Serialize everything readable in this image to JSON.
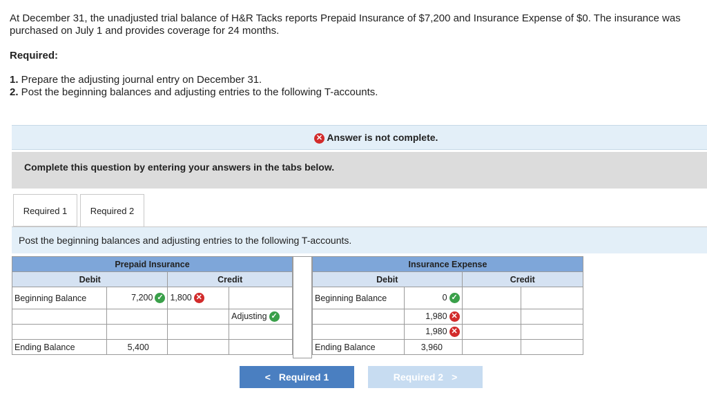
{
  "question": {
    "intro": "At December 31, the unadjusted trial balance of H&R Tacks reports Prepaid Insurance of $7,200 and Insurance Expense of $0. The insurance was purchased on July 1 and provides coverage for 24 months.",
    "required_heading": "Required:",
    "items": [
      {
        "num": "1.",
        "text": " Prepare the adjusting journal entry on December 31."
      },
      {
        "num": "2.",
        "text": " Post the beginning balances and adjusting entries to the following T-accounts."
      }
    ]
  },
  "status": {
    "message": "Answer is not complete.",
    "icon": "x-circle-icon",
    "color": "#d22b2b"
  },
  "instructions": "Complete this question by entering your answers in the tabs below.",
  "tabs": [
    {
      "label": "Required 1",
      "active": false
    },
    {
      "label": "Required 2",
      "active": true
    }
  ],
  "panel_text": "Post the beginning balances and adjusting entries to the following T-accounts.",
  "accounts": {
    "prepaid": {
      "title": "Prepaid Insurance",
      "debit_label": "Debit",
      "credit_label": "Credit",
      "beginning_label": "Beginning Balance",
      "beginning_debit": "7,200",
      "beginning_credit": "1,800",
      "adjusting_label": "Adjusting",
      "ending_label": "Ending Balance",
      "ending_debit": "5,400"
    },
    "expense": {
      "title": "Insurance Expense",
      "debit_label": "Debit",
      "credit_label": "Credit",
      "beginning_label": "Beginning Balance",
      "beginning_debit": "0",
      "row2_debit": "1,980",
      "row3_debit": "1,980",
      "ending_label": "Ending Balance",
      "ending_debit": "3,960"
    }
  },
  "nav": {
    "prev_label": "Required 1",
    "next_label": "Required 2"
  },
  "colors": {
    "correct": "#3aa04a",
    "incorrect": "#d22b2b",
    "header": "#7ea6d9",
    "primary_button": "#4a7fc1"
  }
}
